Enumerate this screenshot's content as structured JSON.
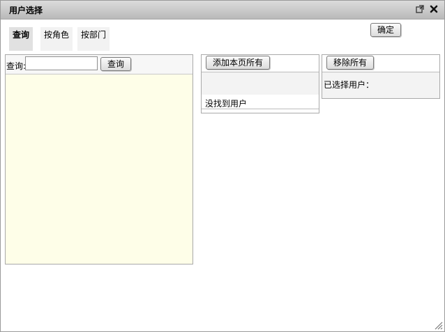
{
  "dialog": {
    "title": "用户选择",
    "restore_icon": "popout-icon",
    "close_icon": "close-icon"
  },
  "tabs": [
    {
      "label": "查询",
      "active": true
    },
    {
      "label": "按角色",
      "active": false
    },
    {
      "label": "按部门",
      "active": false
    }
  ],
  "confirm_label": "确定",
  "search": {
    "label": "查询:",
    "input_value": "",
    "button_label": "查询"
  },
  "user_list": {
    "add_all_label": "添加本页所有",
    "empty_text": "没找到用户"
  },
  "selected": {
    "remove_all_label": "移除所有",
    "label": "已选择用户："
  },
  "colors": {
    "titlebar": "#c8c8c8",
    "tree_background": "#fefee8",
    "active_tab": "#e1e1e1"
  }
}
